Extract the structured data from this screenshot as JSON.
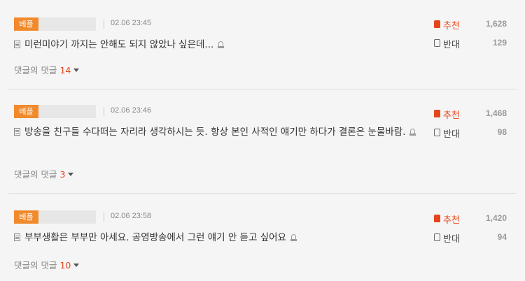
{
  "comments": [
    {
      "badge": "베플",
      "date": "02.06 23:45",
      "text": "미런미야기 까지는 안해도 되지 않았나 싶은데...",
      "replies_label": "댓글의 댓글",
      "reply_count": "14",
      "up_label": "추천",
      "up_count": "1,628",
      "down_label": "반대",
      "down_count": "129"
    },
    {
      "badge": "베플",
      "date": "02.06 23:46",
      "text": "방송을 친구들 수다떠는 자리라 생각하시는 듯. 항상 본인 사적인 얘기만 하다가 결론은 눈물바람.",
      "replies_label": "댓글의 댓글",
      "reply_count": "3",
      "up_label": "추천",
      "up_count": "1,468",
      "down_label": "반대",
      "down_count": "98"
    },
    {
      "badge": "베플",
      "date": "02.06 23:58",
      "text": "부부생활은 부부만 아세요. 공영방송에서 그런 얘기 안 듣고 싶어요",
      "replies_label": "댓글의 댓글",
      "reply_count": "10",
      "up_label": "추천",
      "up_count": "1,420",
      "down_label": "반대",
      "down_count": "94"
    }
  ],
  "colors": {
    "accent": "#e5451b",
    "badge": "#f08a2c",
    "background": "#f5f5f5"
  },
  "icons": [
    "document-icon",
    "report-icon",
    "thumbs-up-icon",
    "thumbs-down-icon",
    "caret-down-icon"
  ]
}
